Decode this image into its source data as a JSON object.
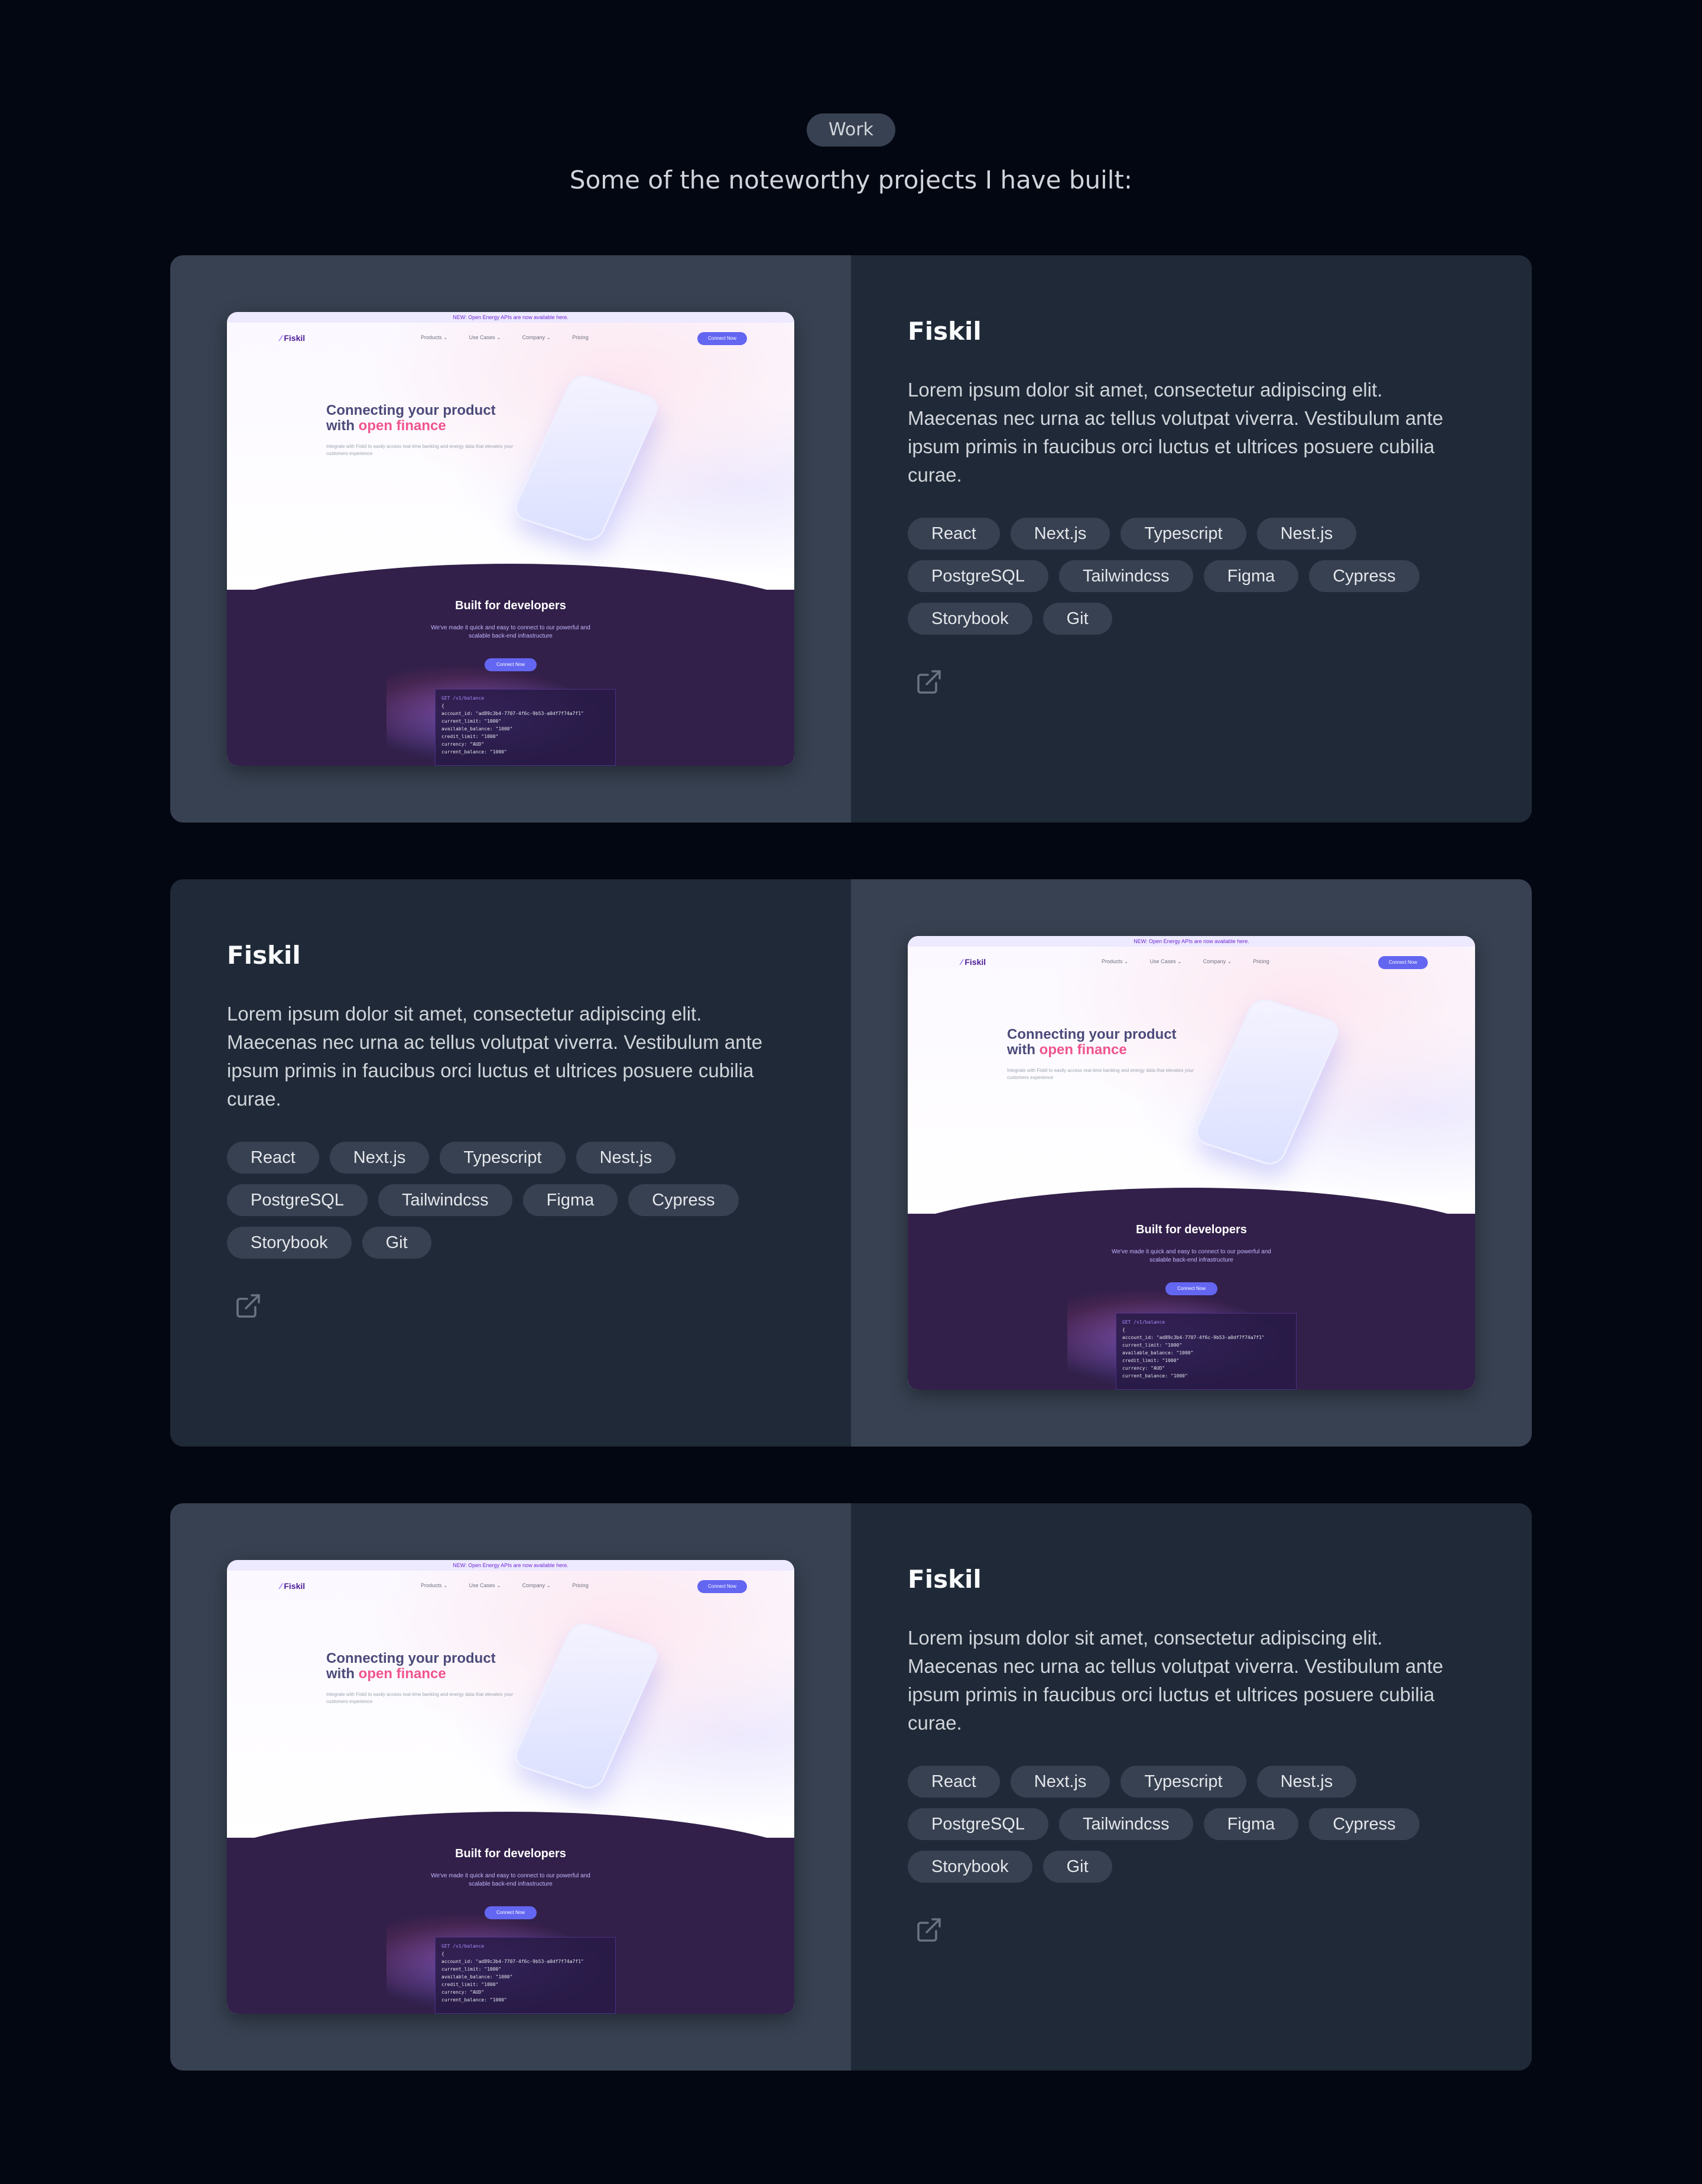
{
  "header": {
    "badge": "Work",
    "subtitle": "Some of the noteworthy projects I have built:"
  },
  "projects": [
    {
      "title": "Fiskil",
      "description": "Lorem ipsum dolor sit amet, consectetur adipiscing elit. Maecenas nec urna ac tellus volutpat viverra. Vestibulum ante ipsum primis in faucibus orci luctus et ultrices posuere cubilia curae.",
      "tags": [
        "React",
        "Next.js",
        "Typescript",
        "Nest.js",
        "PostgreSQL",
        "Tailwindcss",
        "Figma",
        "Cypress",
        "Storybook",
        "Git"
      ],
      "link_icon": "external-link-icon"
    },
    {
      "title": "Fiskil",
      "description": "Lorem ipsum dolor sit amet, consectetur adipiscing elit. Maecenas nec urna ac tellus volutpat viverra. Vestibulum ante ipsum primis in faucibus orci luctus et ultrices posuere cubilia curae.",
      "tags": [
        "React",
        "Next.js",
        "Typescript",
        "Nest.js",
        "PostgreSQL",
        "Tailwindcss",
        "Figma",
        "Cypress",
        "Storybook",
        "Git"
      ],
      "link_icon": "external-link-icon"
    },
    {
      "title": "Fiskil",
      "description": "Lorem ipsum dolor sit amet, consectetur adipiscing elit. Maecenas nec urna ac tellus volutpat viverra. Vestibulum ante ipsum primis in faucibus orci luctus et ultrices posuere cubilia curae.",
      "tags": [
        "React",
        "Next.js",
        "Typescript",
        "Nest.js",
        "PostgreSQL",
        "Tailwindcss",
        "Figma",
        "Cypress",
        "Storybook",
        "Git"
      ],
      "link_icon": "external-link-icon"
    }
  ],
  "mock_site": {
    "banner": "NEW: Open Energy APIs are now available here.",
    "logo": "Fiskil",
    "nav": [
      "Products ⌄",
      "Use Cases ⌄",
      "Company ⌄",
      "Pricing"
    ],
    "nav_cta": "Connect Now",
    "headline_1": "Connecting your product",
    "headline_2_plain": "with ",
    "headline_2_accent": "open finance",
    "hero_sub": "Integrate with Fiskil to easily access real-time banking and energy data that elevates your customers experience",
    "dev_title": "Built for developers",
    "dev_sub": "We've made it quick and easy to connect to our powerful and scalable back-end infrastructure",
    "dev_cta": "Connect Now",
    "code_header": "GET /v1/balance",
    "code_lines": [
      "{",
      "  account_id: \"ad89c3b4-7707-4f6c-9b53-a0df7f74a7f1\"",
      "  current_limit: \"1000\"",
      "  available_balance: \"1000\"",
      "  credit_limit: \"1000\"",
      "  currency: \"AUD\"",
      "  current_balance: \"1000\""
    ]
  },
  "colors": {
    "page_bg": "#030712",
    "card_light": "#374151",
    "card_dark": "#1f2937",
    "tag_bg": "#374151",
    "accent_indigo": "#6366f1",
    "accent_pink": "#f0548f"
  }
}
